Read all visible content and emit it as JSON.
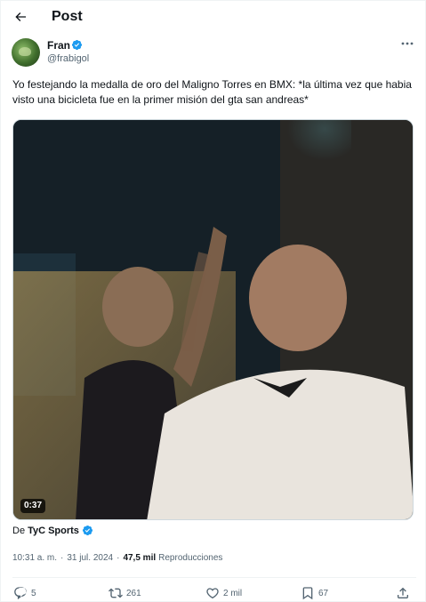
{
  "header": {
    "title": "Post",
    "back_icon": "arrow-left-icon"
  },
  "author": {
    "name": "Fran",
    "handle": "@frabigol",
    "verified": true,
    "more_icon": "more-horizontal-icon"
  },
  "tweet": {
    "text": "Yo festejando la medalla de oro del Maligno Torres en BMX: *la última vez que habia visto una bicicleta fue en la primer misión del gta san andreas*"
  },
  "media": {
    "type": "video",
    "duration": "0:37"
  },
  "source": {
    "prefix": "De",
    "name": "TyC Sports",
    "verified": true
  },
  "meta": {
    "time": "10:31 a. m.",
    "separator": "·",
    "date": "31 jul. 2024",
    "views_count": "47,5 mil",
    "views_label": "Reproducciones"
  },
  "actions": {
    "replies": "5",
    "reposts": "261",
    "likes": "2 mil",
    "bookmarks": "67"
  },
  "colors": {
    "verified": "#1d9bf0",
    "text": "#0f1419",
    "secondary": "#536471",
    "border": "#eff3f4"
  }
}
